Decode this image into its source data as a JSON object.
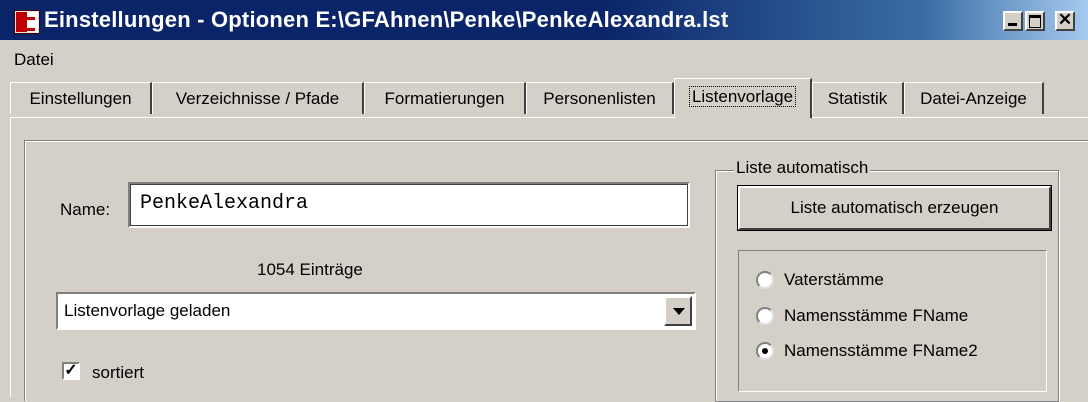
{
  "window": {
    "title": "Einstellungen - Optionen  E:\\GFAhnen\\Penke\\PenkeAlexandra.lst",
    "min_icon": "minimize-icon",
    "max_icon": "maximize-icon",
    "close_glyph": "✕"
  },
  "menu": {
    "items": [
      {
        "label": "Datei"
      }
    ]
  },
  "tabs": [
    {
      "label": "Einstellungen"
    },
    {
      "label": "Verzeichnisse / Pfade"
    },
    {
      "label": "Formatierungen"
    },
    {
      "label": "Personenlisten"
    },
    {
      "label": "Listenvorlage",
      "active": true
    },
    {
      "label": "Statistik"
    },
    {
      "label": "Datei-Anzeige"
    }
  ],
  "form": {
    "name_label": "Name:",
    "name_value": "PenkeAlexandra",
    "entry_count": "1054 Einträge",
    "combo_value": "Listenvorlage geladen",
    "sorted_label": "sortiert",
    "sorted_checked": true,
    "check_mark": "✓"
  },
  "auto_group": {
    "title": "Liste automatisch",
    "button_label": "Liste automatisch erzeugen",
    "options": [
      {
        "label": "Vaterstämme",
        "selected": false
      },
      {
        "label": "Namensstämme  FName",
        "selected": false
      },
      {
        "label": "Namensstämme  FName2",
        "selected": true
      }
    ]
  }
}
